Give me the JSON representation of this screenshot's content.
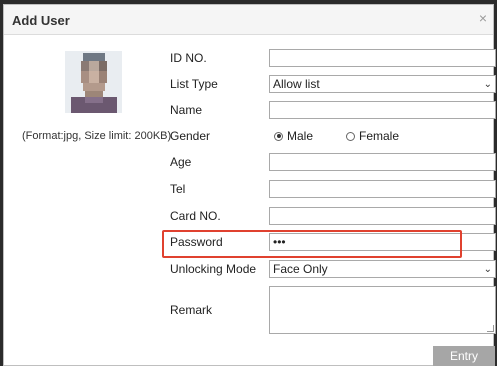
{
  "dialog": {
    "title": "Add User",
    "close_icon": "close-icon"
  },
  "photo": {
    "hint": "(Format:jpg, Size limit: 200KB)"
  },
  "form": {
    "id_no": {
      "label": "ID NO.",
      "value": ""
    },
    "list_type": {
      "label": "List Type",
      "value": "Allow list"
    },
    "name": {
      "label": "Name",
      "value": ""
    },
    "gender": {
      "label": "Gender",
      "options": [
        "Male",
        "Female"
      ],
      "selected": "Male"
    },
    "age": {
      "label": "Age",
      "value": ""
    },
    "tel": {
      "label": "Tel",
      "value": ""
    },
    "card_no": {
      "label": "Card NO.",
      "value": ""
    },
    "password": {
      "label": "Password",
      "value": "•••"
    },
    "unlocking_mode": {
      "label": "Unlocking Mode",
      "value": "Face Only"
    },
    "remark": {
      "label": "Remark",
      "value": ""
    }
  },
  "actions": {
    "entry_label": "Entry"
  },
  "colors": {
    "highlight_border": "#e0412f",
    "entry_button": "#a6a6a6"
  }
}
